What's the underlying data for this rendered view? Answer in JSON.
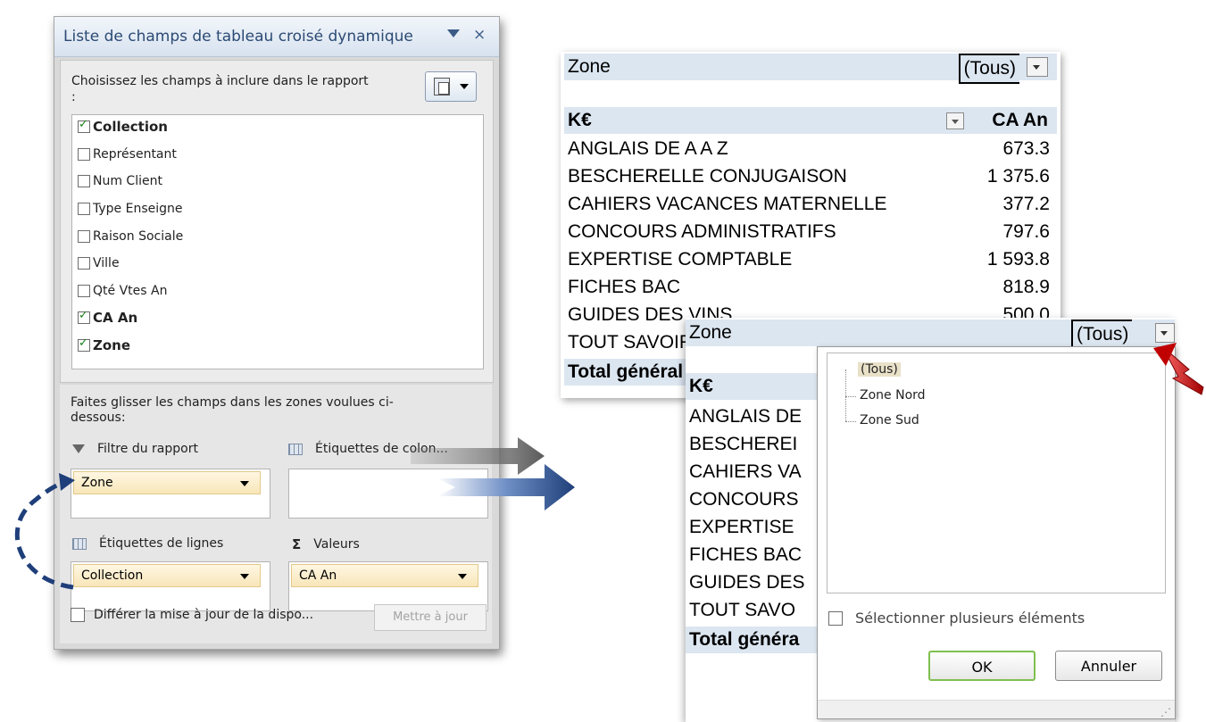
{
  "field_list": {
    "title": "Liste de champs de tableau croisé dynamique",
    "close": "×",
    "prompt": "Choisissez les champs à inclure dans le rapport :",
    "fields": [
      {
        "label": "Collection",
        "checked": true
      },
      {
        "label": "Représentant",
        "checked": false
      },
      {
        "label": "Num Client",
        "checked": false
      },
      {
        "label": "Type Enseigne",
        "checked": false
      },
      {
        "label": "Raison Sociale",
        "checked": false
      },
      {
        "label": "Ville",
        "checked": false
      },
      {
        "label": "Qté Vtes An",
        "checked": false
      },
      {
        "label": "CA An",
        "checked": true
      },
      {
        "label": "Zone",
        "checked": true
      }
    ],
    "drag_prompt": "Faites glisser les champs dans les zones voulues ci-dessous:",
    "areas": {
      "filter_label": "Filtre du rapport",
      "filter_field": "Zone",
      "columns_label": "Étiquettes de colon...",
      "rows_label": "Étiquettes de lignes",
      "rows_field": "Collection",
      "values_label": "Valeurs",
      "values_field": "CA An"
    },
    "defer_label": "Différer la mise à jour de la dispo...",
    "update_button": "Mettre à jour"
  },
  "pivot_top": {
    "filter_label": "Zone",
    "filter_value": "(Tous)",
    "row_header": "K€",
    "column_header": "CA An",
    "rows": [
      {
        "label": "ANGLAIS DE A A Z",
        "value": "673.3"
      },
      {
        "label": "BESCHERELLE CONJUGAISON",
        "value": "1 375.6"
      },
      {
        "label": "CAHIERS VACANCES MATERNELLE",
        "value": "377.2"
      },
      {
        "label": "CONCOURS ADMINISTRATIFS",
        "value": "797.6"
      },
      {
        "label": "EXPERTISE COMPTABLE",
        "value": "1 593.8"
      },
      {
        "label": "FICHES BAC",
        "value": "818.9"
      },
      {
        "label": "GUIDES DES VINS",
        "value": "500.0"
      },
      {
        "label": "TOUT SAVOIR",
        "value": ""
      }
    ],
    "total_label": "Total général"
  },
  "pivot_bottom": {
    "filter_label": "Zone",
    "filter_value": "(Tous)",
    "row_header": "K€",
    "rows": [
      "ANGLAIS DE",
      "BESCHEREI",
      "CAHIERS VA",
      "CONCOURS",
      "EXPERTISE",
      "FICHES BAC",
      "GUIDES DES",
      "TOUT SAVO"
    ],
    "total_label": "Total généra"
  },
  "filter_popup": {
    "items": [
      "(Tous)",
      "Zone Nord",
      "Zone Sud"
    ],
    "multi_select_label": "Sélectionner plusieurs éléments",
    "ok_label": "OK",
    "cancel_label": "Annuler"
  },
  "colors": {
    "header_fill": "#dce6f1",
    "pill_fill": "#f8e6b8",
    "arrow_blue": "#1f3f7a",
    "arrow_red": "#c00000"
  }
}
